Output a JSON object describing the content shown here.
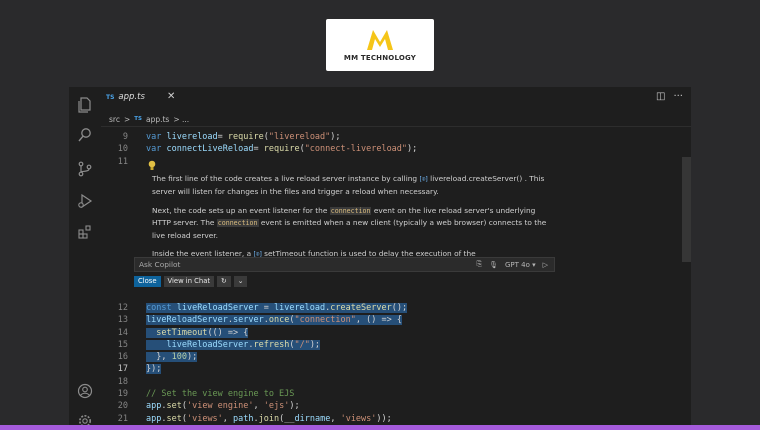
{
  "logo": {
    "name": "MM TECHNOLOGY",
    "color": "#f5c518"
  },
  "activity_bar": {
    "icons": [
      "files-icon",
      "search-icon",
      "source-control-icon",
      "run-debug-icon",
      "extensions-icon",
      "account-icon",
      "settings-gear-icon"
    ]
  },
  "tab": {
    "lang": "TS",
    "filename": "app.ts",
    "close": "✕"
  },
  "breadcrumb": {
    "folder": "src",
    "sep": ">",
    "lang": "TS",
    "file": "app.ts",
    "rest": "> ..."
  },
  "code_top": [
    {
      "num": "9",
      "tokens": [
        [
          "kw",
          "var "
        ],
        [
          "vr",
          "livereload"
        ],
        [
          "",
          "= "
        ],
        [
          "fn",
          "require"
        ],
        [
          "",
          "("
        ],
        [
          "st",
          "\"livereload\""
        ],
        [
          "",
          ");"
        ]
      ]
    },
    {
      "num": "10",
      "tokens": [
        [
          "kw",
          "var "
        ],
        [
          "vr",
          "connectLiveReload"
        ],
        [
          "",
          "= "
        ],
        [
          "fn",
          "require"
        ],
        [
          "",
          "("
        ],
        [
          "st",
          "\"connect-livereload\""
        ],
        [
          "",
          ");"
        ]
      ]
    },
    {
      "num": "11",
      "tokens": []
    }
  ],
  "chat": {
    "p1_a": "The first line of the code creates a live reload server instance by calling",
    "p1_code": "livereload.createServer()",
    "p1_b": ". This server will listen for changes in the files and trigger a reload when necessary.",
    "p2_a": "Next, the code sets up an event listener for the",
    "p2_code1": "connection",
    "p2_b": "event on the live reload server's underlying HTTP server. The",
    "p2_code2": "connection",
    "p2_c": "event is emitted when a new client (typically a web browser) connects to the live reload server.",
    "p3_a": "Inside the event listener, a",
    "p3_code": "setTimeout",
    "p3_b": "function is used to delay the execution of the",
    "ask_placeholder": "Ask Copilot",
    "model": "GPT 4o",
    "close_label": "Close",
    "view_in_chat_label": "View in Chat"
  },
  "code_bottom": [
    {
      "num": "12",
      "sel": true,
      "tokens": [
        [
          "kw",
          "const "
        ],
        [
          "vr",
          "liveReloadServer"
        ],
        [
          "",
          " = "
        ],
        [
          "vr",
          "livereload"
        ],
        [
          "",
          "."
        ],
        [
          "fn",
          "createServer"
        ],
        [
          "",
          "();"
        ]
      ]
    },
    {
      "num": "13",
      "sel": true,
      "tokens": [
        [
          "vr",
          "liveReloadServer"
        ],
        [
          "",
          "."
        ],
        [
          "vr",
          "server"
        ],
        [
          "",
          "."
        ],
        [
          "fn",
          "once"
        ],
        [
          "",
          "("
        ],
        [
          "st",
          "\"connection\""
        ],
        [
          "",
          ", () => {"
        ]
      ]
    },
    {
      "num": "14",
      "sel": true,
      "tokens": [
        [
          "",
          "  "
        ],
        [
          "fn",
          "setTimeout"
        ],
        [
          "",
          "(() => {"
        ]
      ]
    },
    {
      "num": "15",
      "sel": true,
      "tokens": [
        [
          "",
          "    "
        ],
        [
          "vr",
          "liveReloadServer"
        ],
        [
          "",
          "."
        ],
        [
          "fn",
          "refresh"
        ],
        [
          "",
          "("
        ],
        [
          "st",
          "\"/\""
        ],
        [
          "",
          ");"
        ]
      ]
    },
    {
      "num": "16",
      "sel": true,
      "tokens": [
        [
          "",
          "  }, "
        ],
        [
          "nm",
          "100"
        ],
        [
          "",
          ");"
        ]
      ]
    },
    {
      "num": "17",
      "sel": true,
      "active": true,
      "tokens": [
        [
          "",
          "});"
        ]
      ]
    },
    {
      "num": "18",
      "tokens": []
    },
    {
      "num": "19",
      "tokens": [
        [
          "cm",
          "// Set the view engine to EJS"
        ]
      ]
    },
    {
      "num": "20",
      "tokens": [
        [
          "vr",
          "app"
        ],
        [
          "",
          "."
        ],
        [
          "fn",
          "set"
        ],
        [
          "",
          "("
        ],
        [
          "st",
          "'view engine'"
        ],
        [
          "",
          ", "
        ],
        [
          "st",
          "'ejs'"
        ],
        [
          "",
          ");"
        ]
      ]
    },
    {
      "num": "21",
      "tokens": [
        [
          "vr",
          "app"
        ],
        [
          "",
          "."
        ],
        [
          "fn",
          "set"
        ],
        [
          "",
          "("
        ],
        [
          "st",
          "'views'"
        ],
        [
          "",
          ", "
        ],
        [
          "vr",
          "path"
        ],
        [
          "",
          "."
        ],
        [
          "fn",
          "join"
        ],
        [
          "",
          "(__"
        ],
        [
          "vr",
          "dirname"
        ],
        [
          "",
          ", "
        ],
        [
          "st",
          "'views'"
        ],
        [
          "",
          "));"
        ]
      ]
    }
  ]
}
